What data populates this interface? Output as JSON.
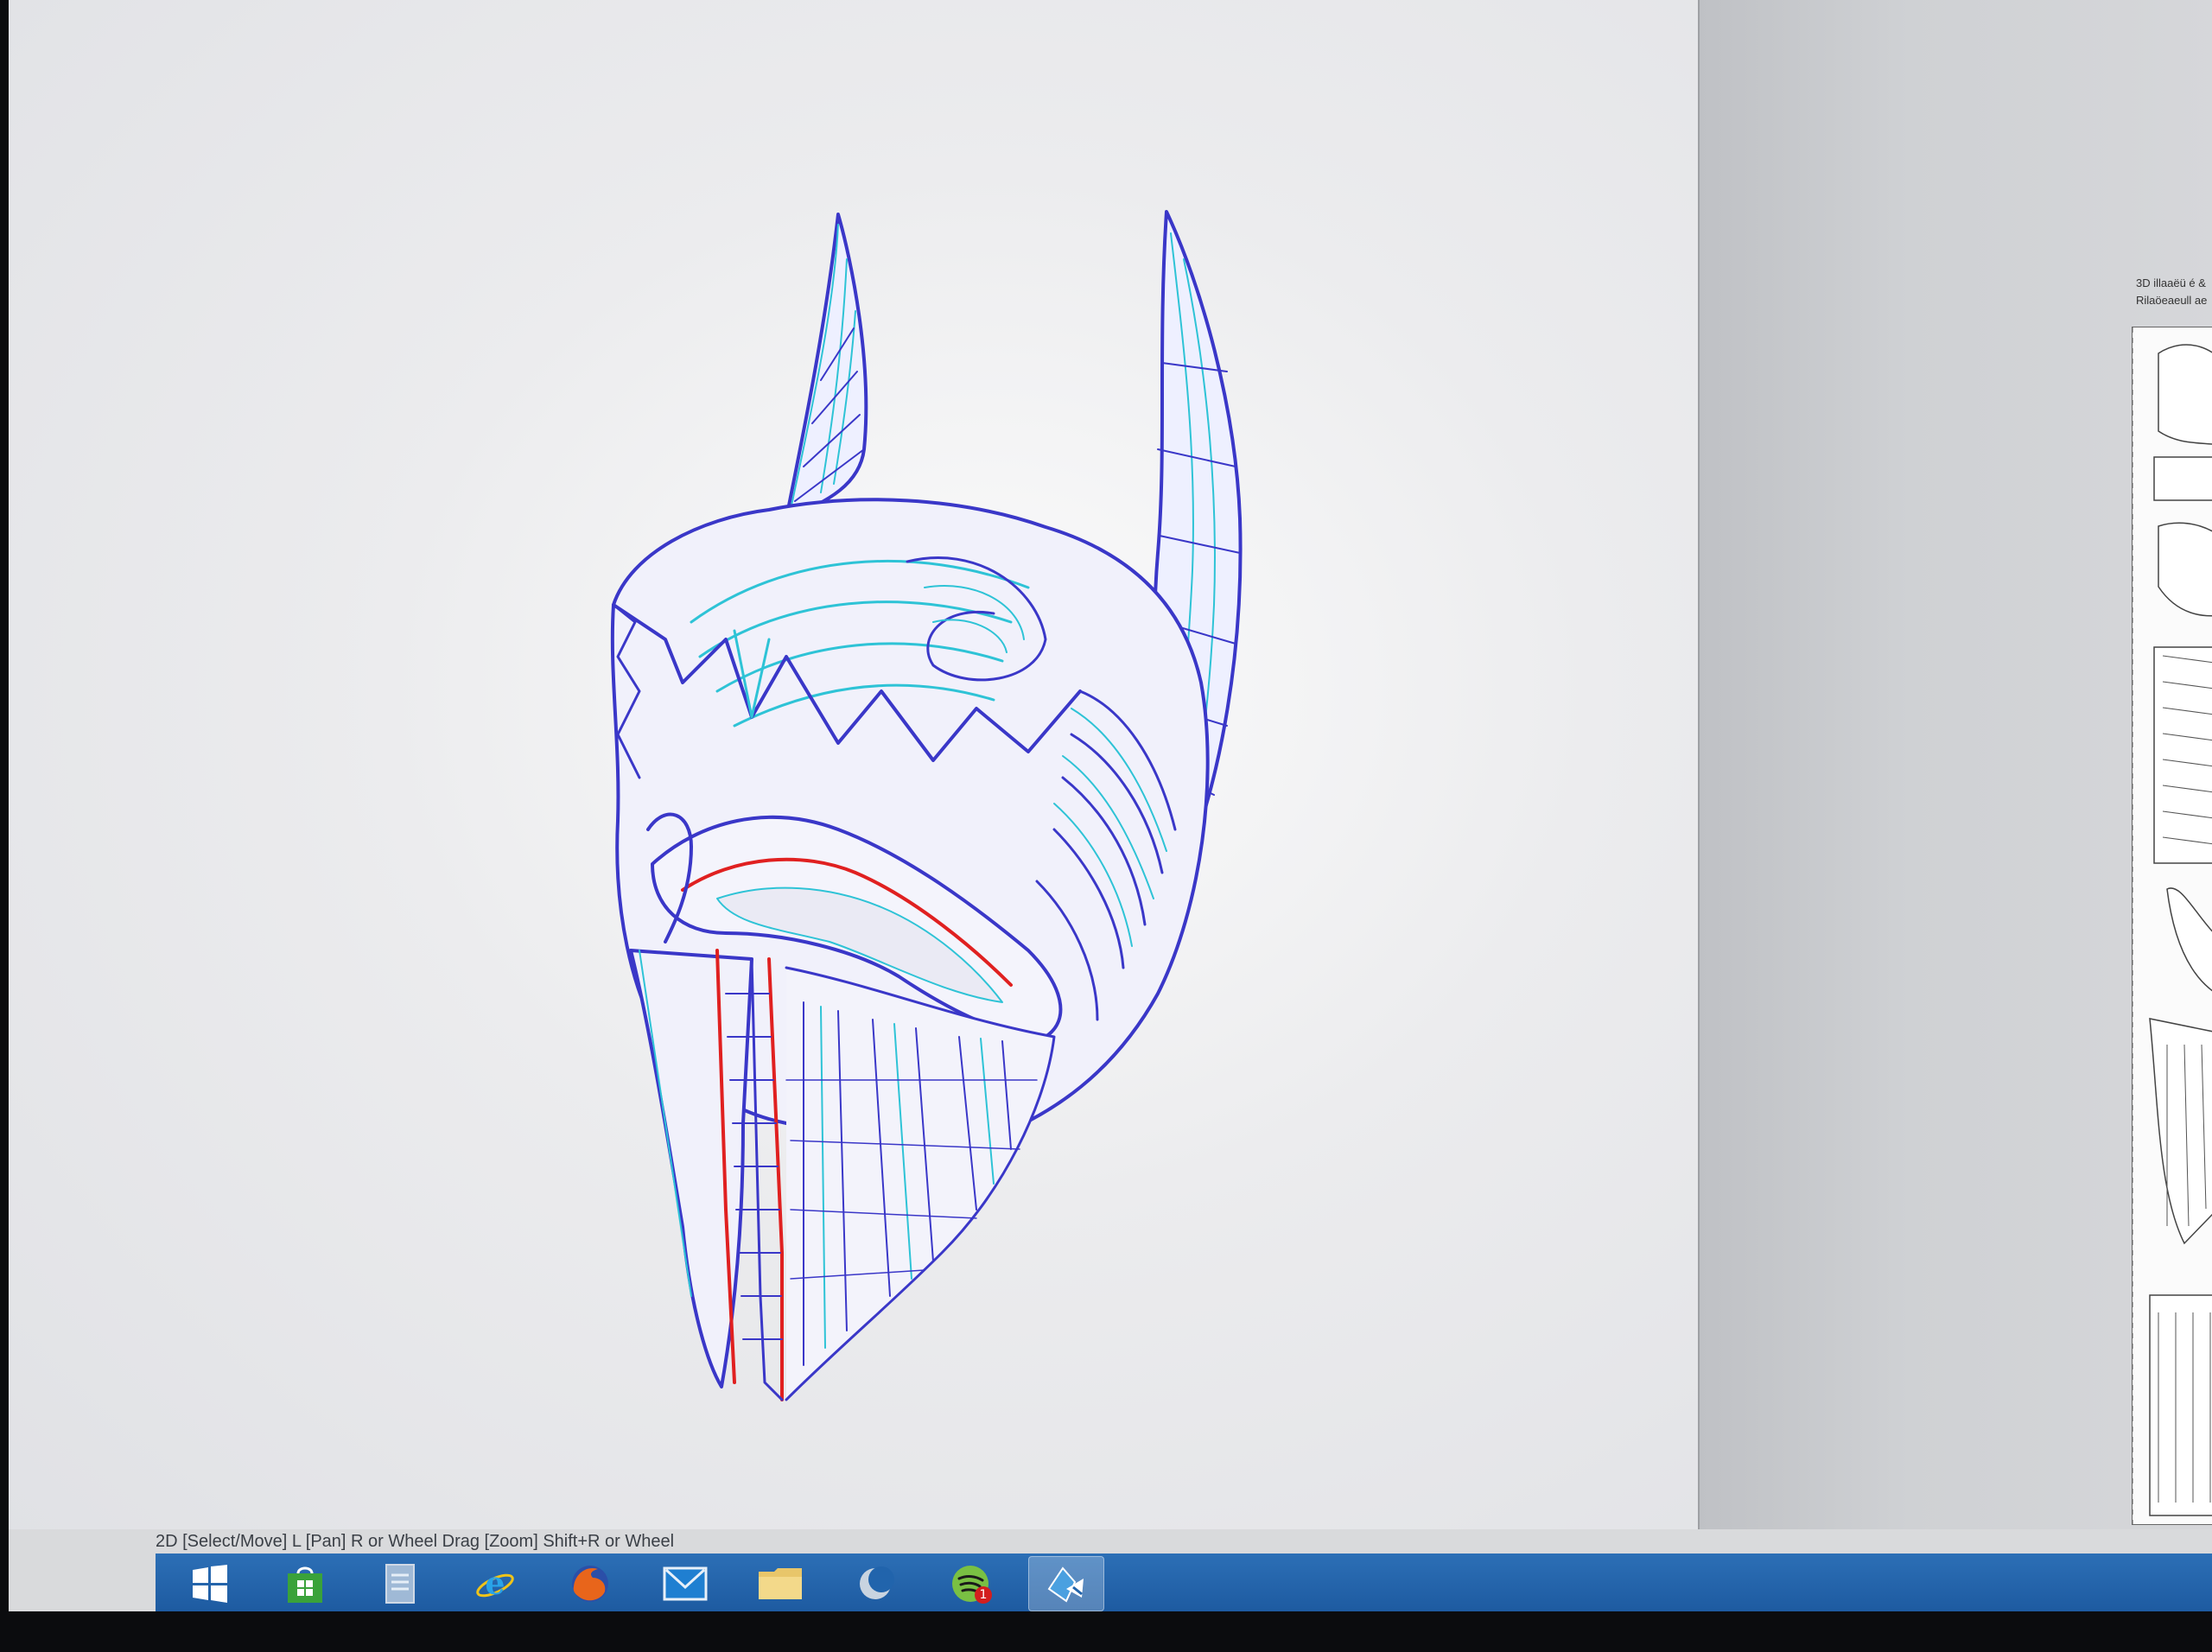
{
  "status_bar": {
    "hint": "2D [Select/Move] L [Pan] R or Wheel Drag [Zoom] Shift+R or Wheel"
  },
  "view2d": {
    "title_line1": "3D illaaëü é &",
    "title_line2": "Rilaöeaeull ae"
  },
  "taskbar": {
    "items": [
      {
        "name": "start-button",
        "icon": "windows-logo-icon"
      },
      {
        "name": "store-button",
        "icon": "store-bag-icon"
      },
      {
        "name": "file-manager-button",
        "icon": "document-icon"
      },
      {
        "name": "internet-explorer-button",
        "icon": "internet-explorer-icon"
      },
      {
        "name": "firefox-button",
        "icon": "firefox-icon"
      },
      {
        "name": "mail-button",
        "icon": "envelope-icon"
      },
      {
        "name": "explorer-button",
        "icon": "folder-icon"
      },
      {
        "name": "eclipse-app-button",
        "icon": "crescent-icon"
      },
      {
        "name": "spotify-button",
        "icon": "spotify-icon",
        "badge": "1"
      },
      {
        "name": "pepakura-button",
        "icon": "pepakura-icon",
        "active": true
      }
    ]
  },
  "colors": {
    "mesh_edge": "#3a37c8",
    "mesh_fold": "#2ec3d6",
    "cut_line": "#e02020",
    "taskbar": "#2164ac"
  }
}
